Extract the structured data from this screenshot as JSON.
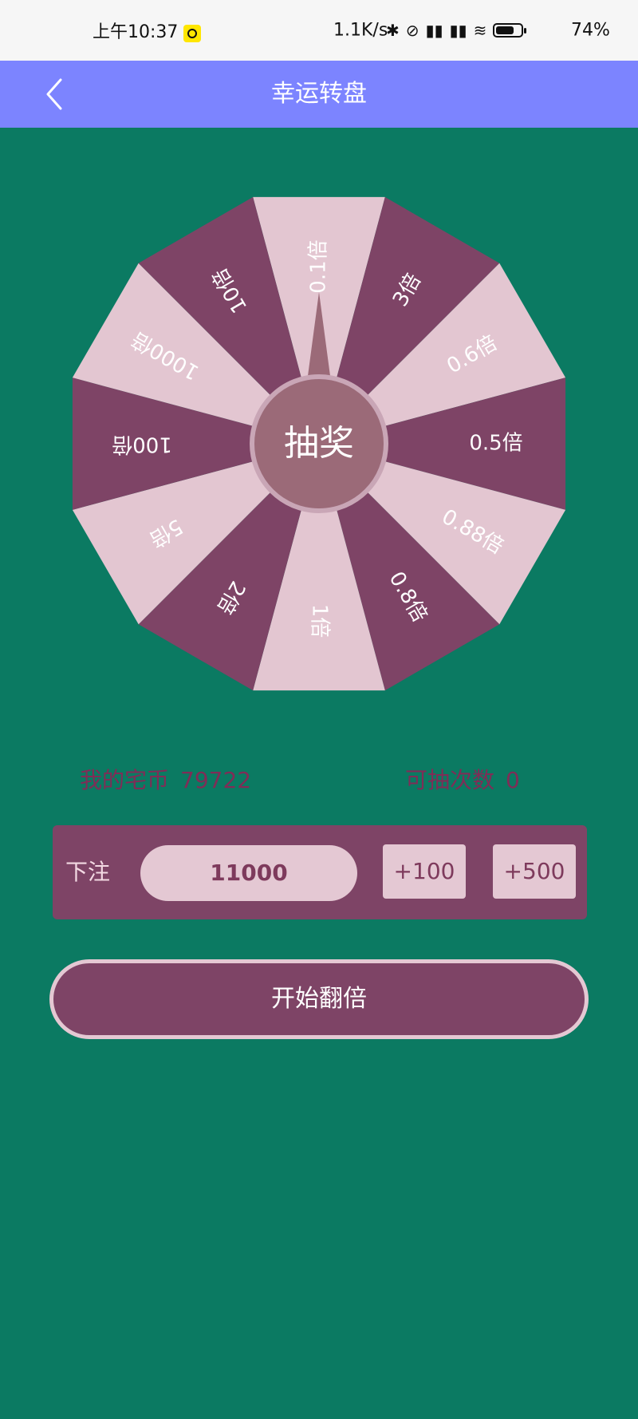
{
  "status": {
    "time": "上午10:37",
    "speed": "1.1K/s",
    "battery": "74%",
    "battery_level": 0.74
  },
  "header": {
    "title": "幸运转盘"
  },
  "wheel": {
    "center_label": "抽奖",
    "segments": [
      "0.1倍",
      "3倍",
      "0.6倍",
      "0.5倍",
      "0.88倍",
      "0.8倍",
      "1倍",
      "2倍",
      "5倍",
      "100倍",
      "1000倍",
      "10倍"
    ],
    "colors": {
      "light": "#e3c6d1",
      "dark": "#7e4466",
      "hub": "#9b6a78",
      "hub_border": "#c9a6b6"
    }
  },
  "info": {
    "coins_label": "我的宅币",
    "coins_value": "79722",
    "draws_label": "可抽次数",
    "draws_value": "0"
  },
  "bet": {
    "label": "下注",
    "amount": "11000",
    "plus100": "+100",
    "plus500": "+500"
  },
  "actions": {
    "start": "开始翻倍"
  }
}
